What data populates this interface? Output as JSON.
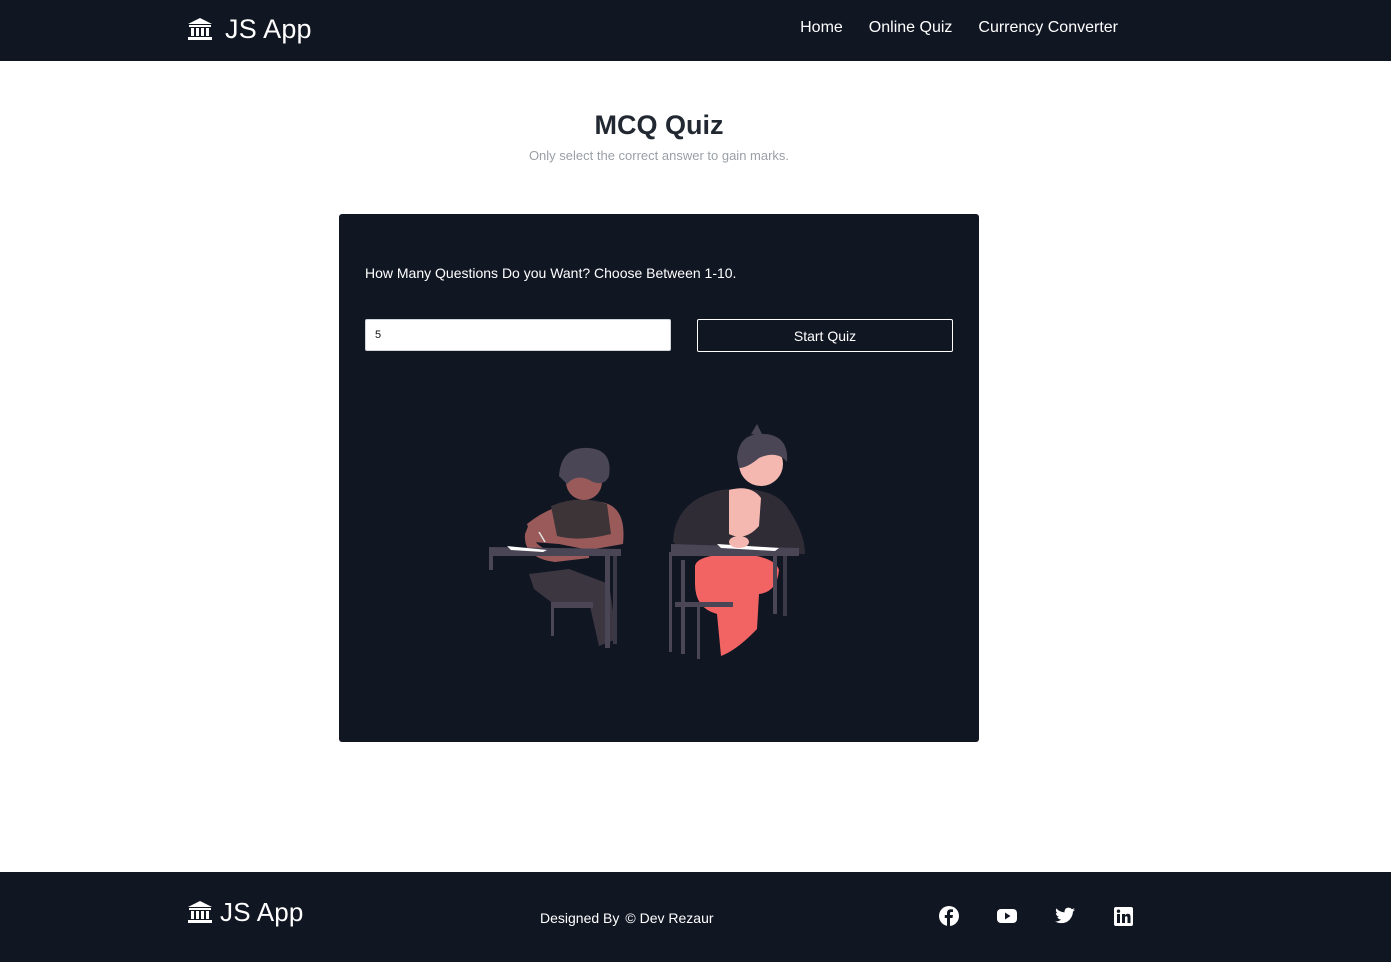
{
  "app": {
    "brand_name": "JS App",
    "brand_icon": "bank-icon"
  },
  "nav": {
    "items": [
      "Home",
      "Online Quiz",
      "Currency Converter"
    ]
  },
  "main": {
    "title": "MCQ Quiz",
    "subtitle": "Only select the correct answer to gain marks.",
    "question_prompt": "How Many Questions Do you Want? Choose Between 1-10.",
    "count_input_value": "5",
    "start_button_label": "Start Quiz",
    "illustration": "two-students-writing-exam-illustration"
  },
  "footer": {
    "brand_name": "JS App",
    "designed_by_label": "Designed By",
    "designer": "© Dev Rezaur",
    "social_icons": [
      "facebook-icon",
      "youtube-icon",
      "twitter-icon",
      "linkedin-icon"
    ]
  },
  "colors": {
    "dark_bg": "#111623",
    "text_light": "#ffffff",
    "accent_pants": "#f26463",
    "skin_dark": "#9a5a5a",
    "skin_light": "#f5b8b0"
  }
}
